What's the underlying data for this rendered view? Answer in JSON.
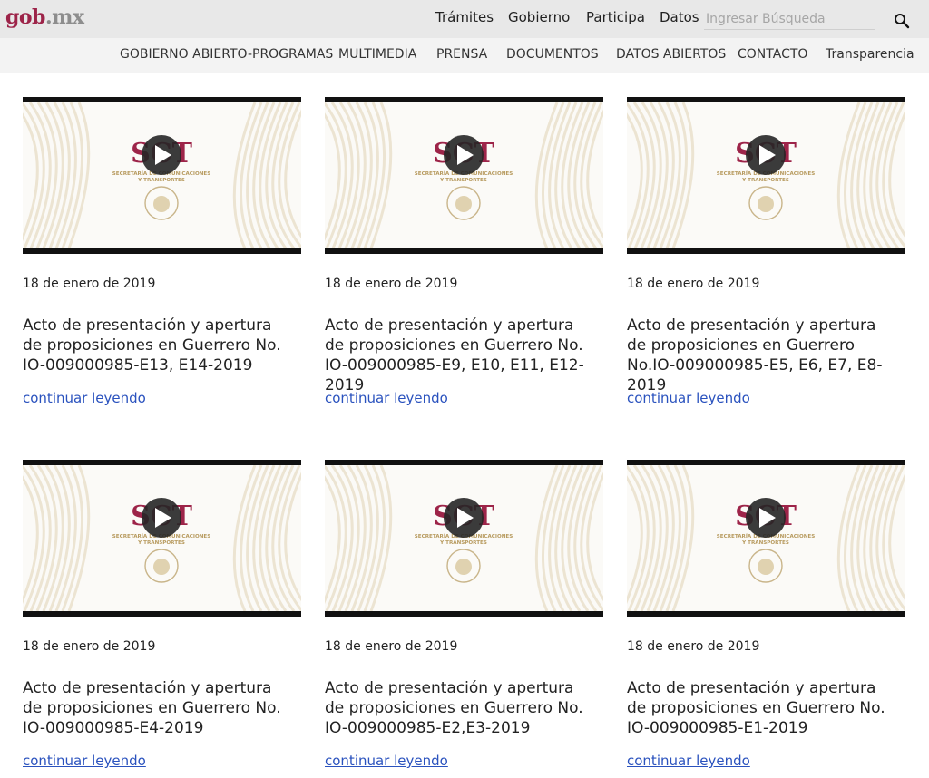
{
  "header": {
    "logo_gob": "gob",
    "logo_mx": ".mx",
    "nav": [
      "Trámites",
      "Gobierno",
      "Participa",
      "Datos"
    ],
    "search_placeholder": "Ingresar Búsqueda"
  },
  "subnav": [
    "GOBIERNO ABIERTO-PROGRAMAS",
    "MULTIMEDIA",
    "PRENSA",
    "DOCUMENTOS",
    "DATOS ABIERTOS",
    "CONTACTO",
    "Transparencia"
  ],
  "thumbnail": {
    "logo": "SCT",
    "line1": "SECRETARÍA DE COMUNICACIONES",
    "line2": "Y TRANSPORTES"
  },
  "cards": [
    {
      "date": "18 de enero de 2019",
      "title": "Acto de presentación y apertura de proposiciones en Guerrero No. IO-009000985-E13, E14-2019",
      "link": "continuar leyendo"
    },
    {
      "date": "18 de enero de 2019",
      "title": "Acto de presentación y apertura de proposiciones en Guerrero No. IO-009000985-E9, E10, E11, E12-2019",
      "link": "continuar leyendo"
    },
    {
      "date": "18 de enero de 2019",
      "title": "Acto de presentación y apertura de proposiciones en Guerrero No.IO-009000985-E5, E6, E7, E8-2019",
      "link": "continuar leyendo"
    },
    {
      "date": "18 de enero de 2019",
      "title": "Acto de presentación y apertura de proposiciones en Guerrero No. IO-009000985-E4-2019",
      "link": "continuar leyendo"
    },
    {
      "date": "18 de enero de 2019",
      "title": "Acto de presentación y apertura de proposiciones en Guerrero No. IO-009000985-E2,E3-2019",
      "link": "continuar leyendo"
    },
    {
      "date": "18 de enero de 2019",
      "title": "Acto de presentación y apertura de proposiciones en Guerrero No. IO-009000985-E1-2019",
      "link": "continuar leyendo"
    }
  ]
}
